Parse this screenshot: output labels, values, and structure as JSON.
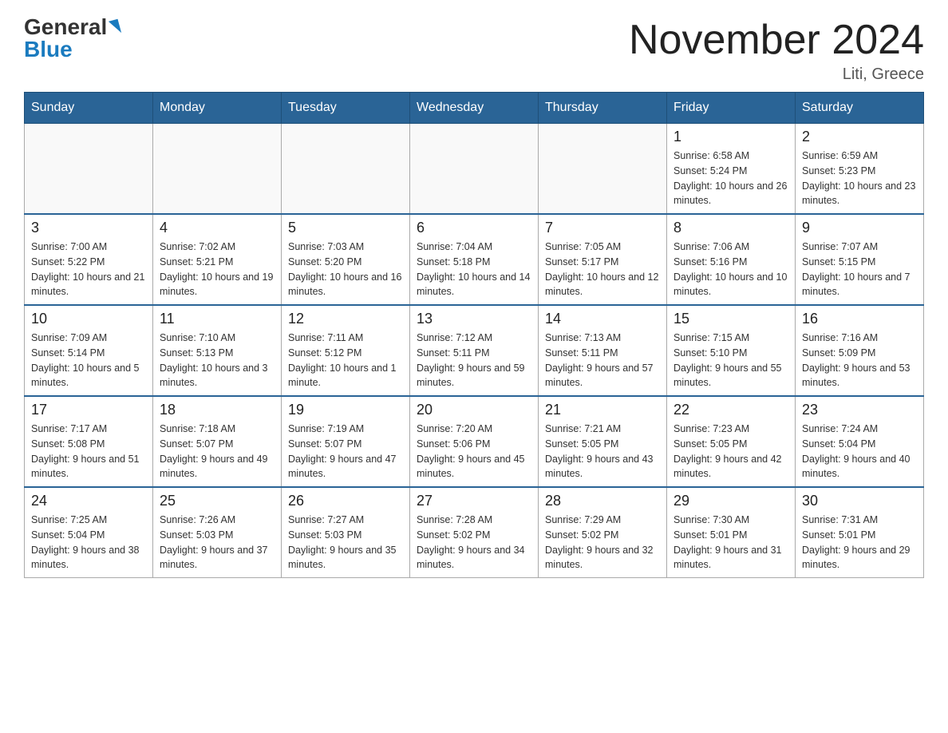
{
  "logo": {
    "general": "General",
    "blue": "Blue"
  },
  "header": {
    "month": "November 2024",
    "location": "Liti, Greece"
  },
  "weekdays": [
    "Sunday",
    "Monday",
    "Tuesday",
    "Wednesday",
    "Thursday",
    "Friday",
    "Saturday"
  ],
  "weeks": [
    [
      {
        "day": "",
        "info": ""
      },
      {
        "day": "",
        "info": ""
      },
      {
        "day": "",
        "info": ""
      },
      {
        "day": "",
        "info": ""
      },
      {
        "day": "",
        "info": ""
      },
      {
        "day": "1",
        "info": "Sunrise: 6:58 AM\nSunset: 5:24 PM\nDaylight: 10 hours and 26 minutes."
      },
      {
        "day": "2",
        "info": "Sunrise: 6:59 AM\nSunset: 5:23 PM\nDaylight: 10 hours and 23 minutes."
      }
    ],
    [
      {
        "day": "3",
        "info": "Sunrise: 7:00 AM\nSunset: 5:22 PM\nDaylight: 10 hours and 21 minutes."
      },
      {
        "day": "4",
        "info": "Sunrise: 7:02 AM\nSunset: 5:21 PM\nDaylight: 10 hours and 19 minutes."
      },
      {
        "day": "5",
        "info": "Sunrise: 7:03 AM\nSunset: 5:20 PM\nDaylight: 10 hours and 16 minutes."
      },
      {
        "day": "6",
        "info": "Sunrise: 7:04 AM\nSunset: 5:18 PM\nDaylight: 10 hours and 14 minutes."
      },
      {
        "day": "7",
        "info": "Sunrise: 7:05 AM\nSunset: 5:17 PM\nDaylight: 10 hours and 12 minutes."
      },
      {
        "day": "8",
        "info": "Sunrise: 7:06 AM\nSunset: 5:16 PM\nDaylight: 10 hours and 10 minutes."
      },
      {
        "day": "9",
        "info": "Sunrise: 7:07 AM\nSunset: 5:15 PM\nDaylight: 10 hours and 7 minutes."
      }
    ],
    [
      {
        "day": "10",
        "info": "Sunrise: 7:09 AM\nSunset: 5:14 PM\nDaylight: 10 hours and 5 minutes."
      },
      {
        "day": "11",
        "info": "Sunrise: 7:10 AM\nSunset: 5:13 PM\nDaylight: 10 hours and 3 minutes."
      },
      {
        "day": "12",
        "info": "Sunrise: 7:11 AM\nSunset: 5:12 PM\nDaylight: 10 hours and 1 minute."
      },
      {
        "day": "13",
        "info": "Sunrise: 7:12 AM\nSunset: 5:11 PM\nDaylight: 9 hours and 59 minutes."
      },
      {
        "day": "14",
        "info": "Sunrise: 7:13 AM\nSunset: 5:11 PM\nDaylight: 9 hours and 57 minutes."
      },
      {
        "day": "15",
        "info": "Sunrise: 7:15 AM\nSunset: 5:10 PM\nDaylight: 9 hours and 55 minutes."
      },
      {
        "day": "16",
        "info": "Sunrise: 7:16 AM\nSunset: 5:09 PM\nDaylight: 9 hours and 53 minutes."
      }
    ],
    [
      {
        "day": "17",
        "info": "Sunrise: 7:17 AM\nSunset: 5:08 PM\nDaylight: 9 hours and 51 minutes."
      },
      {
        "day": "18",
        "info": "Sunrise: 7:18 AM\nSunset: 5:07 PM\nDaylight: 9 hours and 49 minutes."
      },
      {
        "day": "19",
        "info": "Sunrise: 7:19 AM\nSunset: 5:07 PM\nDaylight: 9 hours and 47 minutes."
      },
      {
        "day": "20",
        "info": "Sunrise: 7:20 AM\nSunset: 5:06 PM\nDaylight: 9 hours and 45 minutes."
      },
      {
        "day": "21",
        "info": "Sunrise: 7:21 AM\nSunset: 5:05 PM\nDaylight: 9 hours and 43 minutes."
      },
      {
        "day": "22",
        "info": "Sunrise: 7:23 AM\nSunset: 5:05 PM\nDaylight: 9 hours and 42 minutes."
      },
      {
        "day": "23",
        "info": "Sunrise: 7:24 AM\nSunset: 5:04 PM\nDaylight: 9 hours and 40 minutes."
      }
    ],
    [
      {
        "day": "24",
        "info": "Sunrise: 7:25 AM\nSunset: 5:04 PM\nDaylight: 9 hours and 38 minutes."
      },
      {
        "day": "25",
        "info": "Sunrise: 7:26 AM\nSunset: 5:03 PM\nDaylight: 9 hours and 37 minutes."
      },
      {
        "day": "26",
        "info": "Sunrise: 7:27 AM\nSunset: 5:03 PM\nDaylight: 9 hours and 35 minutes."
      },
      {
        "day": "27",
        "info": "Sunrise: 7:28 AM\nSunset: 5:02 PM\nDaylight: 9 hours and 34 minutes."
      },
      {
        "day": "28",
        "info": "Sunrise: 7:29 AM\nSunset: 5:02 PM\nDaylight: 9 hours and 32 minutes."
      },
      {
        "day": "29",
        "info": "Sunrise: 7:30 AM\nSunset: 5:01 PM\nDaylight: 9 hours and 31 minutes."
      },
      {
        "day": "30",
        "info": "Sunrise: 7:31 AM\nSunset: 5:01 PM\nDaylight: 9 hours and 29 minutes."
      }
    ]
  ]
}
